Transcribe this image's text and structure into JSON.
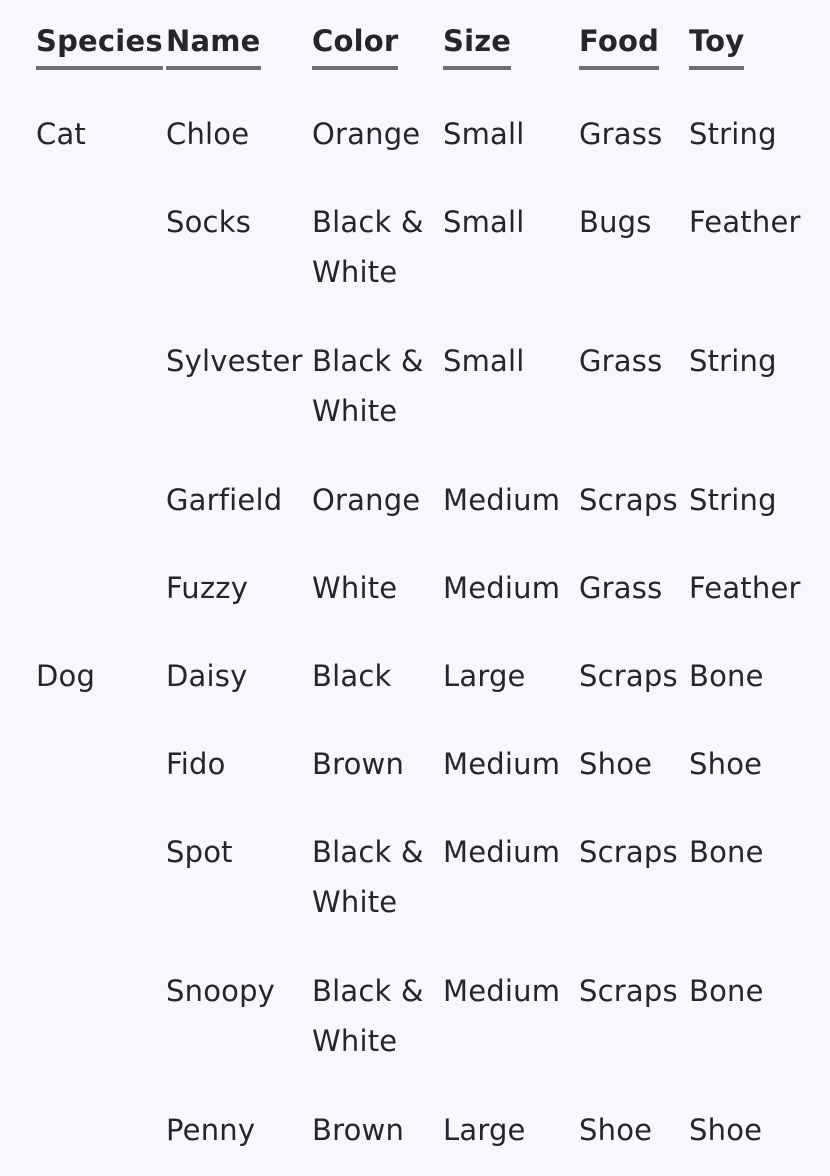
{
  "columns": [
    "Species",
    "Name",
    "Color",
    "Size",
    "Food",
    "Toy"
  ],
  "rows": [
    {
      "species": "Cat",
      "name": "Chloe",
      "color": "Orange",
      "size": "Small",
      "food": "Grass",
      "toy": "String"
    },
    {
      "species": "",
      "name": "Socks",
      "color": "Black & White",
      "size": "Small",
      "food": "Bugs",
      "toy": "Feather"
    },
    {
      "species": "",
      "name": "Sylvester",
      "color": "Black & White",
      "size": "Small",
      "food": "Grass",
      "toy": "String"
    },
    {
      "species": "",
      "name": "Garfield",
      "color": "Orange",
      "size": "Medium",
      "food": "Scraps",
      "toy": "String"
    },
    {
      "species": "",
      "name": "Fuzzy",
      "color": "White",
      "size": "Medium",
      "food": "Grass",
      "toy": "Feather"
    },
    {
      "species": "Dog",
      "name": "Daisy",
      "color": "Black",
      "size": "Large",
      "food": "Scraps",
      "toy": "Bone"
    },
    {
      "species": "",
      "name": "Fido",
      "color": "Brown",
      "size": "Medium",
      "food": "Shoe",
      "toy": "Shoe"
    },
    {
      "species": "",
      "name": "Spot",
      "color": "Black & White",
      "size": "Medium",
      "food": "Scraps",
      "toy": "Bone"
    },
    {
      "species": "",
      "name": "Snoopy",
      "color": "Black & White",
      "size": "Medium",
      "food": "Scraps",
      "toy": "Bone"
    },
    {
      "species": "",
      "name": "Penny",
      "color": "Brown",
      "size": "Large",
      "food": "Shoe",
      "toy": "Shoe"
    }
  ]
}
